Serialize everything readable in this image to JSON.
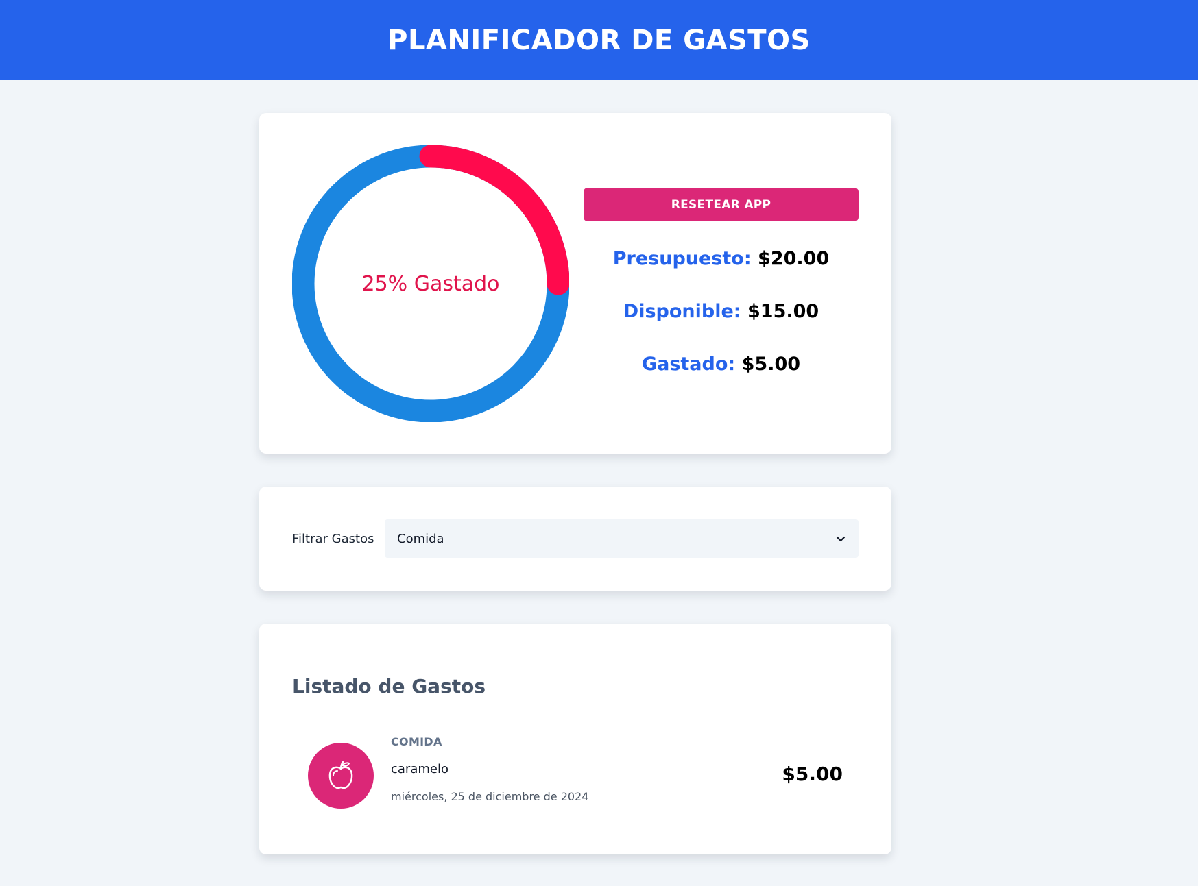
{
  "header": {
    "title": "PLANIFICADOR DE GASTOS"
  },
  "budget": {
    "percent_spent": 25,
    "progress_text": "25% Gastado",
    "reset_label": "RESETEAR APP",
    "budget_label": "Presupuesto:",
    "budget_value": "$20.00",
    "available_label": "Disponible:",
    "available_value": "$15.00",
    "spent_label": "Gastado:",
    "spent_value": "$5.00"
  },
  "filter": {
    "label": "Filtrar Gastos",
    "selected": "Comida"
  },
  "list": {
    "title": "Listado de Gastos",
    "items": [
      {
        "category": "COMIDA",
        "name": "caramelo",
        "date": "miércoles, 25 de diciembre de 2024",
        "amount": "$5.00",
        "icon": "apple-icon"
      }
    ]
  },
  "colors": {
    "header": "#2563eb",
    "accent": "#db2777",
    "ring_track": "#1b86e0",
    "ring_progress": "#ff0a4d"
  }
}
